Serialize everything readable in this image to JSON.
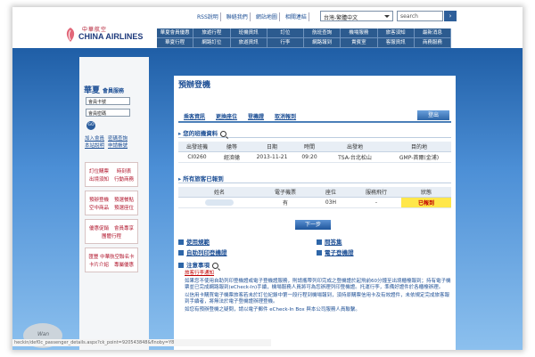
{
  "header": {
    "logo_cn": "中華航空",
    "logo_en": "CHINA AIRLINES",
    "top_links": [
      "RSS說明",
      "聯絡我們",
      "網站地圖",
      "相關連結"
    ],
    "language": "台灣-繁體中文",
    "search_placeholder": "search",
    "nav": [
      "華夏會員優惠",
      "旅遊行程",
      "班機資訊",
      "訂位",
      "航班查詢",
      "機場服務",
      "旅客須知",
      "最新消息",
      "華夏行程",
      "網路訂位",
      "旅遊資訊",
      "行李",
      "網路報到",
      "貴賓室",
      "客服資訊",
      "商務服務"
    ]
  },
  "sidebar": {
    "title": "華夏",
    "subtitle": "會員服務",
    "card_placeholder": "會員卡號",
    "password_placeholder": "會員密碼",
    "go": "GO",
    "links": [
      "加入會員",
      "密碼查詢",
      "本站說明",
      "申請帳號"
    ],
    "buttons": [
      [
        "訂位購票",
        "時刻表",
        "出境須知",
        "行動商務"
      ],
      [
        "預辦登機",
        "預選餐點",
        "空中商品",
        "預選座位"
      ],
      [
        "優惠促銷",
        "會員專享",
        "團體行程"
      ],
      [
        "匯豐 中華航空聯名卡",
        "卡片介紹",
        "專屬優惠"
      ]
    ]
  },
  "main": {
    "page_title": "預辦登機",
    "tabs": [
      "乘客資訊",
      "更換座位",
      "登機證",
      "取消報到"
    ],
    "logout": "登出",
    "section1": "您的班機資料",
    "flight_headers": [
      "出發班機",
      "艙等",
      "日期",
      "時間",
      "出發地",
      "目的地"
    ],
    "flight_row": [
      "CI0260",
      "經濟艙",
      "2013-11-21",
      "09:20",
      "TSA-台北松山",
      "GMP-首爾(金浦)"
    ],
    "section2": "所有旅客已報到",
    "pax_headers": [
      "姓名",
      "電子機票",
      "座位",
      "服務飛行",
      "狀態"
    ],
    "pax_row": [
      "",
      "有",
      "03H",
      "-",
      "已報到"
    ],
    "next": "下一步",
    "quick_links": [
      "使用規範",
      "問答集",
      "自助列印登機證",
      "電子登機證"
    ],
    "notice_title": "注意事項",
    "notice_link": "旅客行李通知",
    "notice_items": [
      "如果您不使用自助列印登機證或電子登機證服務，則請攜帶列印完成之登機證於起飛前60分鐘至出境櫃檯報到；持有電子機票並已完成網路報到(eCheck-In)手續，機場服務人員將可為您辦理列印登機證。托運行李，準備好證件於各櫃檯辦理。",
      "以信用卡購買電子機票旅客若未於訂位紀錄中第一段行程到機場報到，須持原購票信用卡及有效證件，未依規定完成旅客報到手續者，將無法於電子登機證辦理登機。",
      "如您有預辦登機之疑問，請以電子郵件 eCheck-In Box 與本公司服務人員聯繫。"
    ],
    "url": "heckin/def0c_passenger_details.aspx?ck_point=920543848&flnoby=Y8"
  },
  "watermark": "Wan"
}
